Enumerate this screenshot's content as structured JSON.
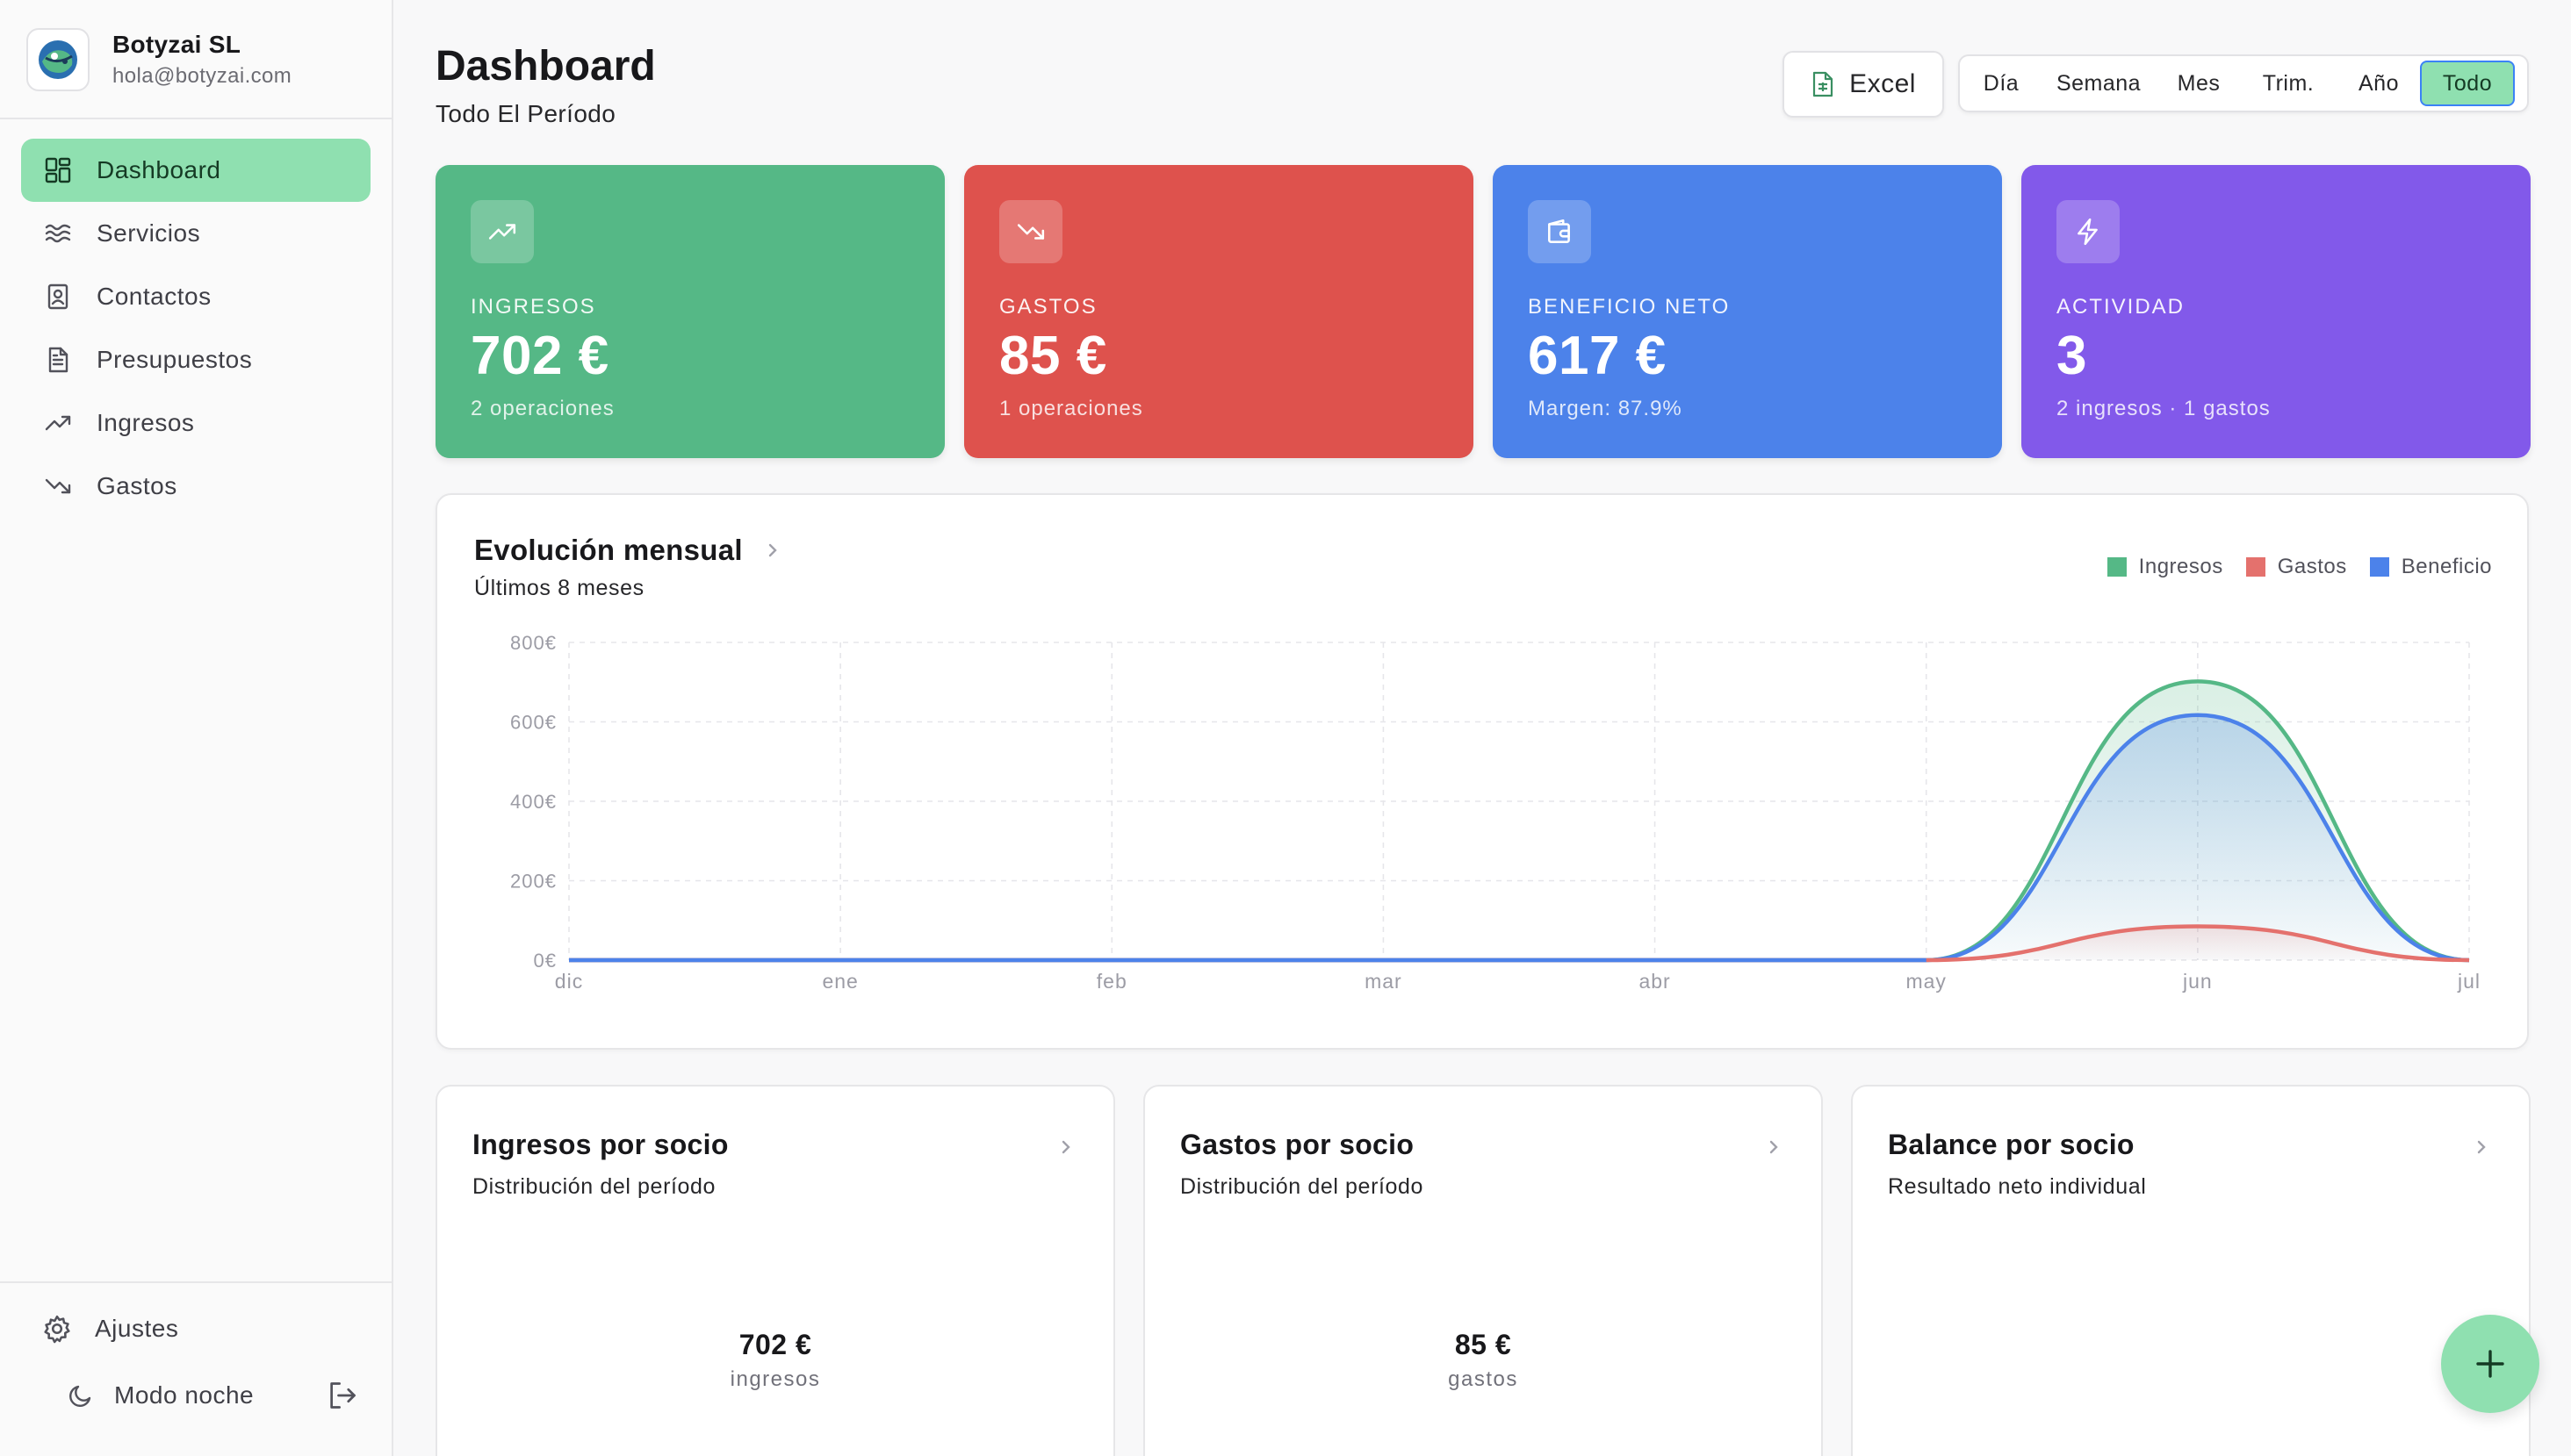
{
  "brand": {
    "name": "Botyzai SL",
    "email": "hola@botyzai.com"
  },
  "sidebar": {
    "items": [
      {
        "label": "Dashboard",
        "icon": "dashboard-grid-icon",
        "active": true
      },
      {
        "label": "Servicios",
        "icon": "waves-icon"
      },
      {
        "label": "Contactos",
        "icon": "contact-book-icon"
      },
      {
        "label": "Presupuestos",
        "icon": "document-icon"
      },
      {
        "label": "Ingresos",
        "icon": "trending-up-icon"
      },
      {
        "label": "Gastos",
        "icon": "trending-down-icon"
      }
    ],
    "settings_label": "Ajustes",
    "night_mode_label": "Modo noche"
  },
  "header": {
    "title": "Dashboard",
    "subtitle": "Todo El Período",
    "excel_label": "Excel",
    "periods": [
      "Día",
      "Semana",
      "Mes",
      "Trim.",
      "Año",
      "Todo"
    ],
    "active_period": "Todo"
  },
  "kpis": [
    {
      "label": "INGRESOS",
      "value": "702 €",
      "sub": "2 operaciones",
      "color": "#55b886",
      "icon": "trending-up-icon"
    },
    {
      "label": "GASTOS",
      "value": "85 €",
      "sub": "1 operaciones",
      "color": "#de524d",
      "icon": "trending-down-icon"
    },
    {
      "label": "BENEFICIO NETO",
      "value": "617 €",
      "sub": "Margen: 87.9%",
      "color": "#4c82ea",
      "icon": "wallet-icon"
    },
    {
      "label": "ACTIVIDAD",
      "value": "3",
      "sub": "2 ingresos · 1 gastos",
      "color": "#8259ea",
      "icon": "lightning-icon"
    }
  ],
  "chart_card": {
    "title": "Evolución mensual",
    "subtitle": "Últimos 8 meses"
  },
  "chart_data": {
    "type": "area",
    "categories": [
      "dic",
      "ene",
      "feb",
      "mar",
      "abr",
      "may",
      "jun",
      "jul"
    ],
    "y_ticks": [
      "0€",
      "200€",
      "400€",
      "600€",
      "800€"
    ],
    "ylim": [
      0,
      800
    ],
    "grid": true,
    "legend_position": "top-right",
    "series": [
      {
        "name": "Ingresos",
        "color": "#55b886",
        "values": [
          0,
          0,
          0,
          0,
          0,
          0,
          702,
          0
        ]
      },
      {
        "name": "Gastos",
        "color": "#e4716d",
        "values": [
          0,
          0,
          0,
          0,
          0,
          0,
          85,
          0
        ]
      },
      {
        "name": "Beneficio",
        "color": "#4c82ea",
        "values": [
          0,
          0,
          0,
          0,
          0,
          0,
          617,
          0
        ]
      }
    ]
  },
  "socio_cards": [
    {
      "title": "Ingresos por socio",
      "subtitle": "Distribución del período",
      "value": "702 €",
      "unit": "ingresos"
    },
    {
      "title": "Gastos por socio",
      "subtitle": "Distribución del período",
      "value": "85 €",
      "unit": "gastos"
    },
    {
      "title": "Balance por socio",
      "subtitle": "Resultado neto individual",
      "value": "",
      "unit": ""
    }
  ]
}
